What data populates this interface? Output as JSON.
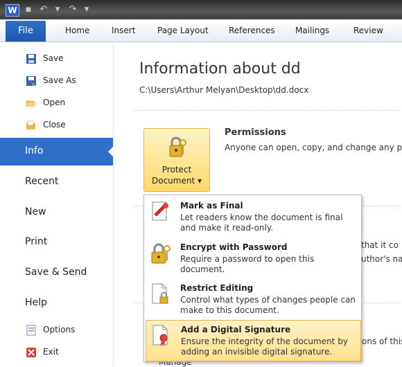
{
  "app": {
    "icon_letter": "W"
  },
  "ribbon": {
    "tabs": [
      "File",
      "Home",
      "Insert",
      "Page Layout",
      "References",
      "Mailings",
      "Review"
    ]
  },
  "backstage_nav": {
    "small_items": [
      {
        "label": "Save",
        "icon": "save-icon"
      },
      {
        "label": "Save As",
        "icon": "save-as-icon"
      },
      {
        "label": "Open",
        "icon": "open-folder-icon"
      },
      {
        "label": "Close",
        "icon": "close-folder-icon"
      }
    ],
    "big_items": [
      "Info",
      "Recent",
      "New",
      "Print",
      "Save & Send",
      "Help"
    ],
    "bottom_items": [
      {
        "label": "Options",
        "icon": "options-icon"
      },
      {
        "label": "Exit",
        "icon": "exit-icon"
      }
    ]
  },
  "info": {
    "heading": "Information about dd",
    "path": "C:\\Users\\Arthur Melyan\\Desktop\\dd.docx",
    "protect_button": {
      "line1": "Protect",
      "line2": "Document ▾"
    },
    "permissions": {
      "title": "Permissions",
      "desc": "Anyone can open, copy, and change any p"
    },
    "bg_fragments": [
      "that it co",
      "uthor's na",
      "ons of this"
    ],
    "manage_partial": "Manage"
  },
  "protect_menu": [
    {
      "title": "Mark as Final",
      "desc": "Let readers know the document is final and make it read-only."
    },
    {
      "title": "Encrypt with Password",
      "desc": "Require a password to open this document."
    },
    {
      "title": "Restrict Editing",
      "desc": "Control what types of changes people can make to this document."
    },
    {
      "title": "Add a Digital Signature",
      "desc": "Ensure the integrity of the document by adding an invisible digital signature."
    }
  ],
  "colors": {
    "accent": "#2f6fc7",
    "highlight": "#ffe08c"
  }
}
